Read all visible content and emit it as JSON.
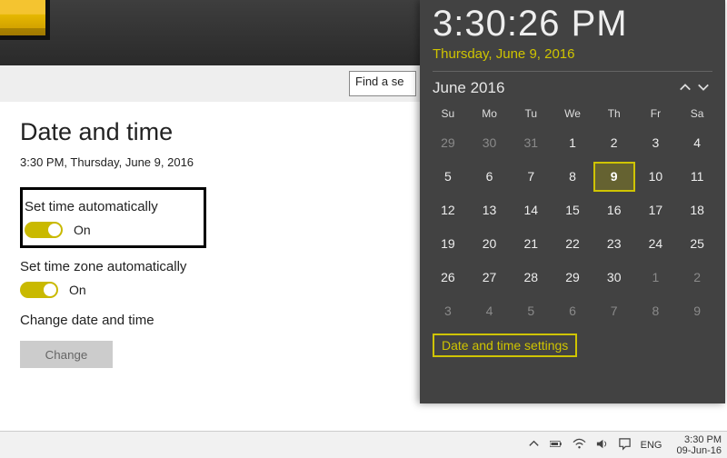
{
  "settings": {
    "search_preview": "Find a se",
    "page_title": "Date and time",
    "current_datetime": "3:30 PM, Thursday, June 9, 2016",
    "set_time_auto": {
      "label": "Set time automatically",
      "state": "On"
    },
    "set_tz_auto": {
      "label": "Set time zone automatically",
      "state": "On"
    },
    "change_section": {
      "label": "Change date and time",
      "button": "Change"
    }
  },
  "flyout": {
    "clock_time": "3:30:26 PM",
    "clock_date": "Thursday, June 9, 2016",
    "month": "June 2016",
    "dow": [
      "Su",
      "Mo",
      "Tu",
      "We",
      "Th",
      "Fr",
      "Sa"
    ],
    "weeks": [
      [
        {
          "n": "29",
          "dim": true
        },
        {
          "n": "30",
          "dim": true
        },
        {
          "n": "31",
          "dim": true
        },
        {
          "n": "1"
        },
        {
          "n": "2"
        },
        {
          "n": "3"
        },
        {
          "n": "4"
        }
      ],
      [
        {
          "n": "5"
        },
        {
          "n": "6"
        },
        {
          "n": "7"
        },
        {
          "n": "8"
        },
        {
          "n": "9",
          "today": true
        },
        {
          "n": "10"
        },
        {
          "n": "11"
        }
      ],
      [
        {
          "n": "12"
        },
        {
          "n": "13"
        },
        {
          "n": "14"
        },
        {
          "n": "15"
        },
        {
          "n": "16"
        },
        {
          "n": "17"
        },
        {
          "n": "18"
        }
      ],
      [
        {
          "n": "19"
        },
        {
          "n": "20"
        },
        {
          "n": "21"
        },
        {
          "n": "22"
        },
        {
          "n": "23"
        },
        {
          "n": "24"
        },
        {
          "n": "25"
        }
      ],
      [
        {
          "n": "26"
        },
        {
          "n": "27"
        },
        {
          "n": "28"
        },
        {
          "n": "29"
        },
        {
          "n": "30"
        },
        {
          "n": "1",
          "dim": true
        },
        {
          "n": "2",
          "dim": true
        }
      ],
      [
        {
          "n": "3",
          "dim": true
        },
        {
          "n": "4",
          "dim": true
        },
        {
          "n": "5",
          "dim": true
        },
        {
          "n": "6",
          "dim": true
        },
        {
          "n": "7",
          "dim": true
        },
        {
          "n": "8",
          "dim": true
        },
        {
          "n": "9",
          "dim": true
        }
      ]
    ],
    "settings_link": "Date and time settings"
  },
  "taskbar": {
    "lang": "ENG",
    "time": "3:30 PM",
    "date": "09-Jun-16"
  }
}
